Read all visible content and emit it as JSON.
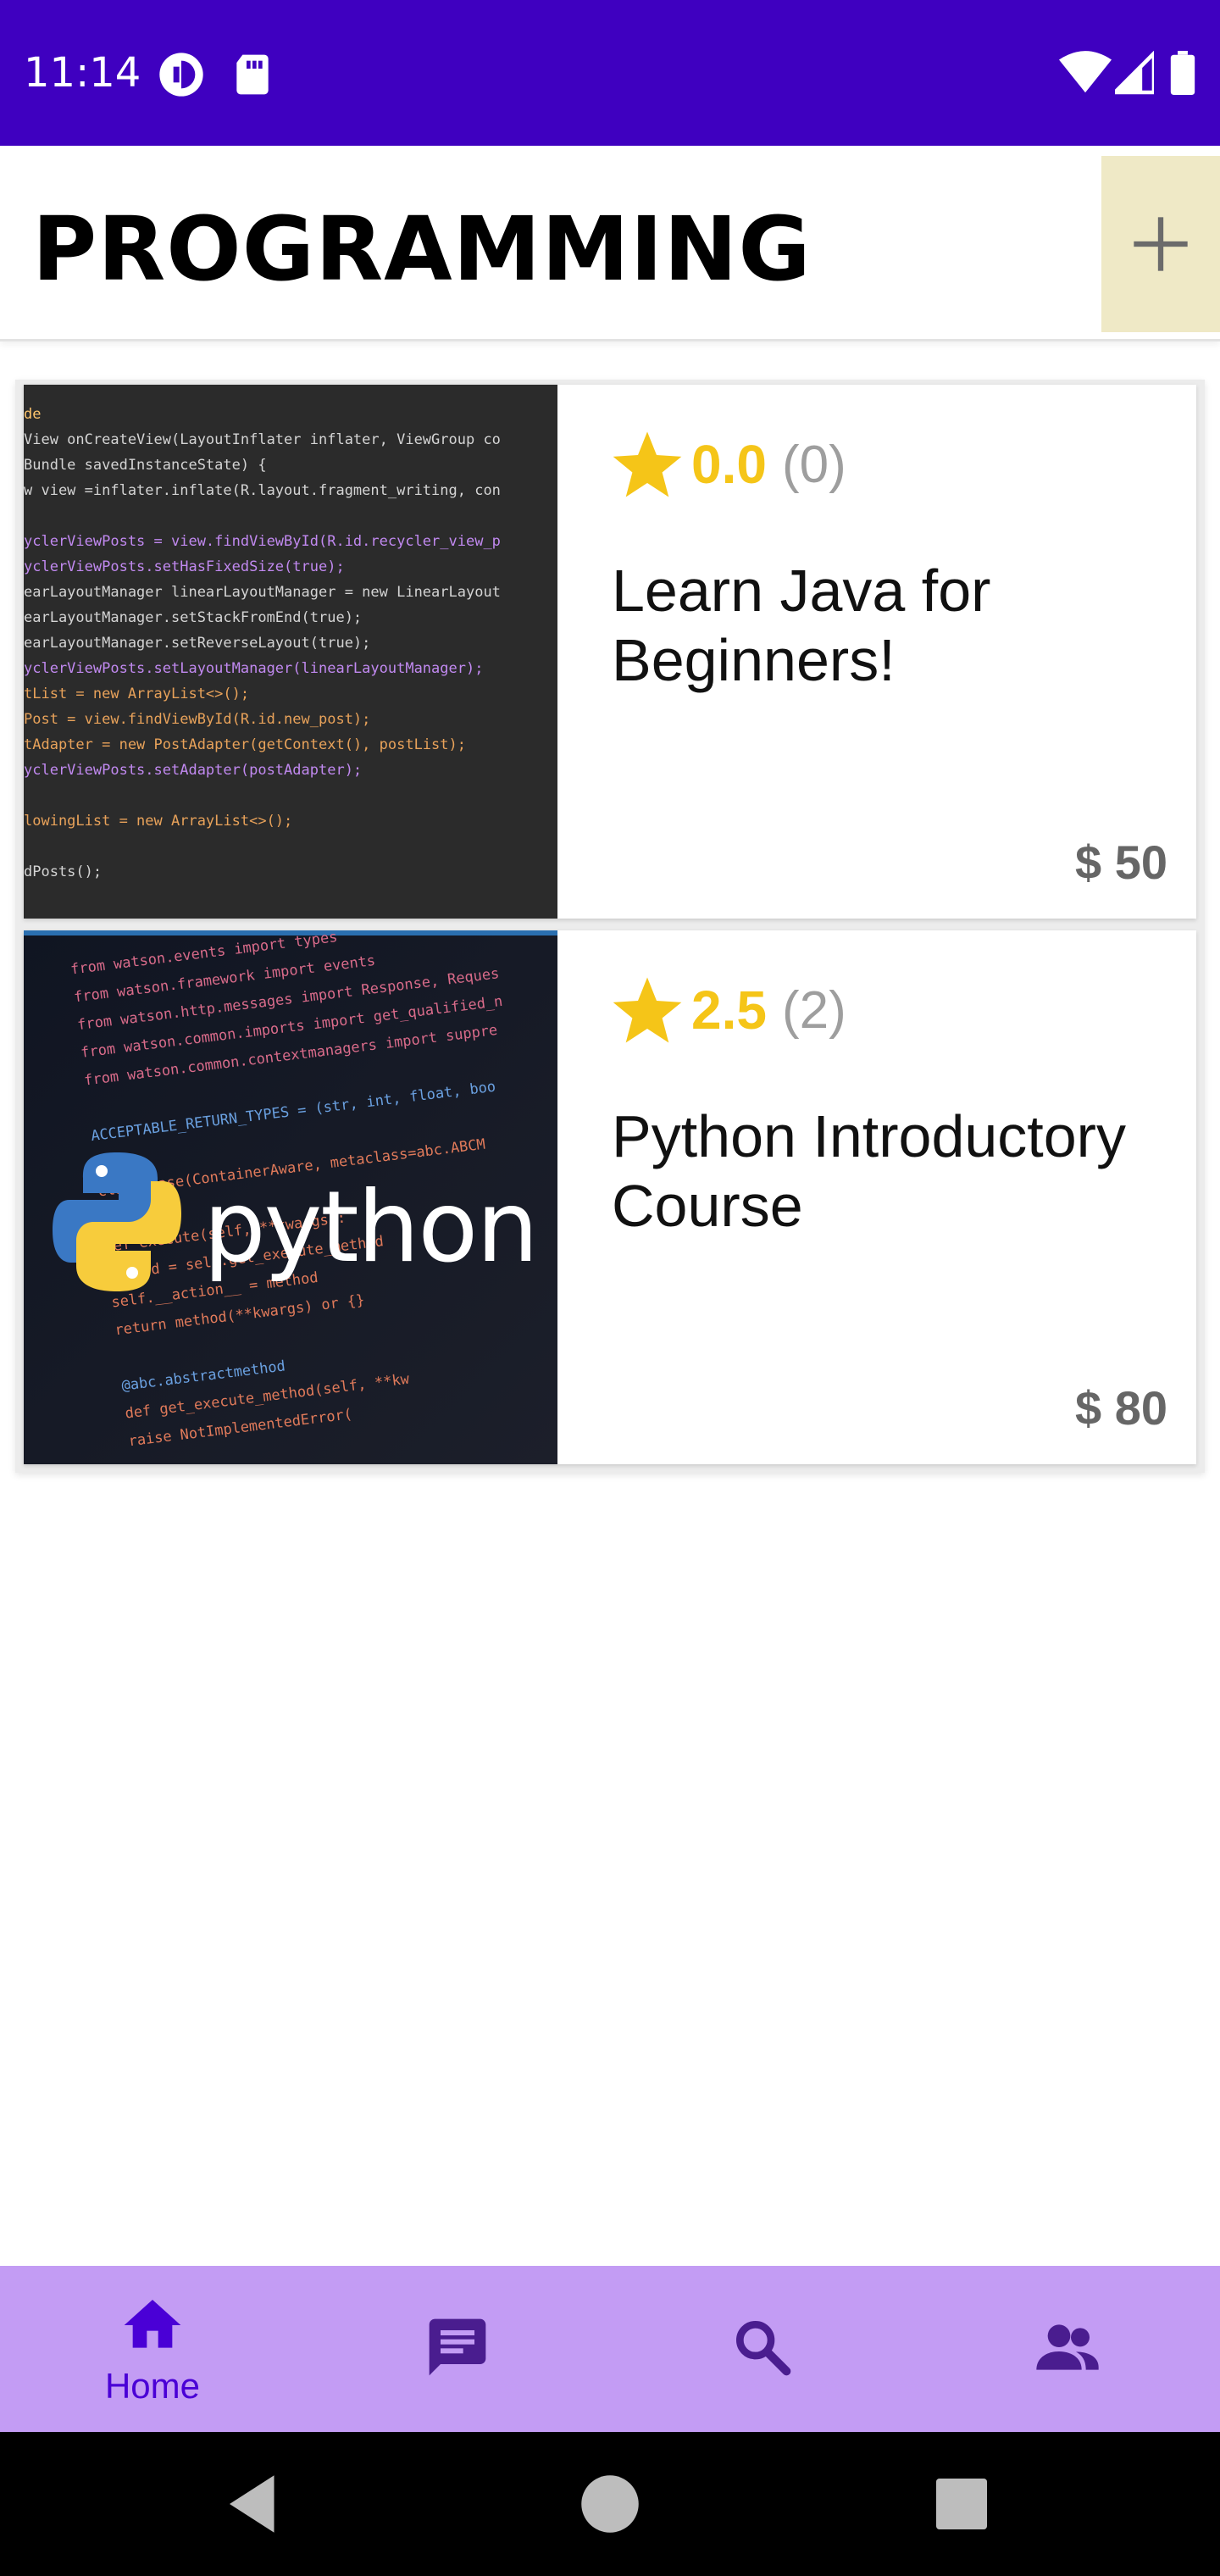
{
  "status_bar": {
    "time": "11:14",
    "icons_left": [
      "status-app-icon",
      "sd-card-icon"
    ],
    "icons_right": [
      "wifi-icon",
      "signal-icon",
      "battery-icon"
    ]
  },
  "app_bar": {
    "title": "PROGRAMMING",
    "add_icon": "plus-icon"
  },
  "courses": [
    {
      "rating": "0.0",
      "rating_count": "(0)",
      "title": "Learn Java for Beginners!",
      "price": "$ 50",
      "image": "java-code-screenshot",
      "code_lines": [
        "de",
        "View onCreateView(LayoutInflater inflater, ViewGroup co",
        "                  Bundle savedInstanceState) {",
        "w view =inflater.inflate(R.layout.fragment_writing, con",
        "",
        "yclerViewPosts = view.findViewById(R.id.recycler_view_p",
        "yclerViewPosts.setHasFixedSize(true);",
        "earLayoutManager linearLayoutManager = new LinearLayout",
        "earLayoutManager.setStackFromEnd(true);",
        "earLayoutManager.setReverseLayout(true);",
        "yclerViewPosts.setLayoutManager(linearLayoutManager);",
        "tList = new ArrayList<>();",
        "Post = view.findViewById(R.id.new_post);",
        "tAdapter = new PostAdapter(getContext(), postList);",
        "yclerViewPosts.setAdapter(postAdapter);",
        "",
        "lowingList = new ArrayList<>();",
        "",
        "dPosts();"
      ]
    },
    {
      "rating": "2.5",
      "rating_count": "(2)",
      "title": "Python Introductory Course",
      "price": "$ 80",
      "image": "python-logo-image",
      "image_text": "python",
      "code_lines": [
        "from watson.events import types",
        "from watson.framework import events",
        "from watson.http.messages import Response, Reques",
        "from watson.common.imports import get_qualified_n",
        "from watson.common.contextmanagers import suppre",
        "",
        "ACCEPTABLE_RETURN_TYPES = (str, int, float, boo",
        "",
        "class Base(ContainerAware, metaclass=abc.ABCM",
        "",
        "def execute(self, **kwargs):",
        "method = self.get_execute_method",
        "self.__action__ = method",
        "return method(**kwargs) or {}",
        "",
        "@abc.abstractmethod",
        "def get_execute_method(self, **kw",
        "raise NotImplementedError("
      ]
    }
  ],
  "bottom_nav": {
    "items": [
      {
        "label": "Home",
        "icon": "home-icon",
        "active": true
      },
      {
        "label": "",
        "icon": "chat-icon",
        "active": false
      },
      {
        "label": "",
        "icon": "search-icon",
        "active": false
      },
      {
        "label": "",
        "icon": "people-icon",
        "active": false
      }
    ]
  },
  "system_nav": {
    "icons": [
      "back-icon",
      "home-circle-icon",
      "recents-icon"
    ]
  },
  "colors": {
    "status_bar": "#3f00c0",
    "add_button_bg": "#efe9c6",
    "rating_star": "#f5c518",
    "bottom_nav_bg": "#c39cf4",
    "nav_active": "#4a00d6",
    "nav_inactive": "#4a1d8f",
    "price_text": "#666666"
  }
}
